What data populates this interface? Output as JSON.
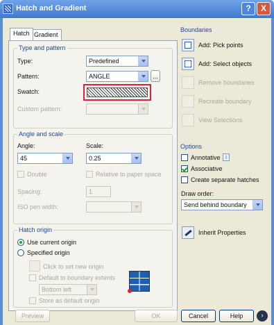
{
  "window": {
    "title": "Hatch and Gradient",
    "help_btn": "?",
    "close_btn": "X"
  },
  "tabs": [
    {
      "label": "Hatch"
    },
    {
      "label": "Gradient"
    }
  ],
  "type_pattern": {
    "title": "Type and pattern",
    "type_label": "Type:",
    "type_value": "Predefined",
    "pattern_label": "Pattern:",
    "pattern_value": "ANGLE",
    "pattern_browse": "...",
    "swatch_label": "Swatch:",
    "custom_label": "Custom pattern:"
  },
  "angle_scale": {
    "title": "Angle and scale",
    "angle_label": "Angle:",
    "angle_value": "45",
    "scale_label": "Scale:",
    "scale_value": "0.25",
    "double_label": "Double",
    "relative_label": "Relative to paper space",
    "spacing_label": "Spacing:",
    "spacing_value": "1",
    "iso_label": "ISO pen width:"
  },
  "origin": {
    "title": "Hatch origin",
    "use_current": "Use current origin",
    "specified": "Specified origin",
    "click_set": "Click to set new origin",
    "default_boundary": "Default to boundary extents",
    "boundary_value": "Bottom left",
    "store_default": "Store as default origin"
  },
  "boundaries": {
    "title": "Boundaries",
    "add_pick": "Add: Pick points",
    "add_select": "Add: Select objects",
    "remove": "Remove boundaries",
    "recreate": "Recreate boundary",
    "view": "View Selections"
  },
  "options": {
    "title": "Options",
    "annotative": "Annotative",
    "associative": "Associative",
    "separate": "Create separate hatches",
    "draw_order_label": "Draw order:",
    "draw_order_value": "Send behind boundary",
    "inherit": "Inherit Properties"
  },
  "footer": {
    "preview": "Preview",
    "ok": "OK",
    "cancel": "Cancel",
    "help": "Help"
  }
}
